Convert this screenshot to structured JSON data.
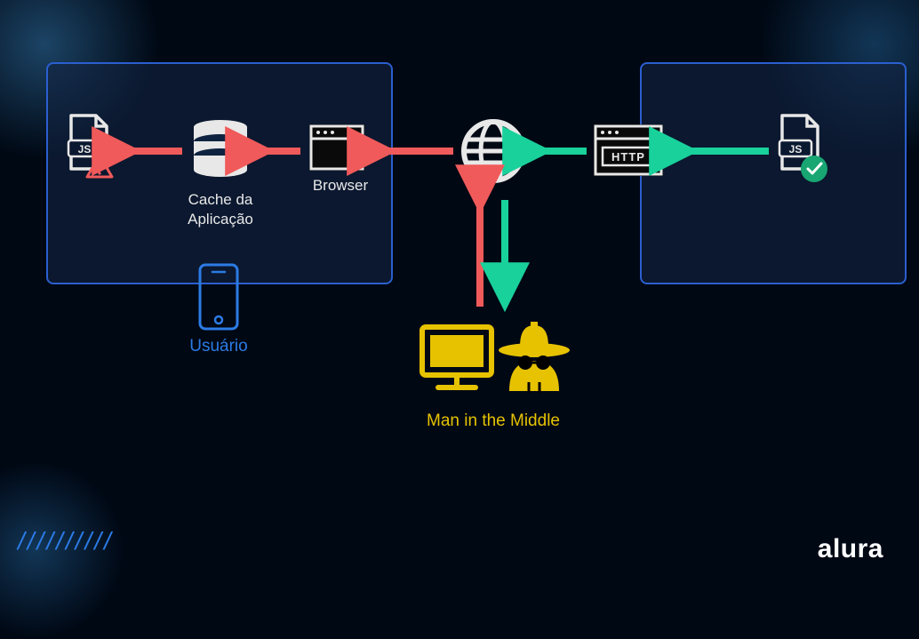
{
  "labels": {
    "browser": "Browser",
    "cache_line1": "Cache da",
    "cache_line2": "Aplicação",
    "user": "Usuário",
    "mitm": "Man in the Middle",
    "http_badge": "HTTP",
    "js_badge": "JS"
  },
  "brand": "alura",
  "colors": {
    "panel_border": "#2b5fcf",
    "arrow_red": "#f05a5a",
    "arrow_green": "#18d19b",
    "yellow": "#e6c200",
    "blue_text": "#2c7be5",
    "white": "#e8e8e8"
  }
}
